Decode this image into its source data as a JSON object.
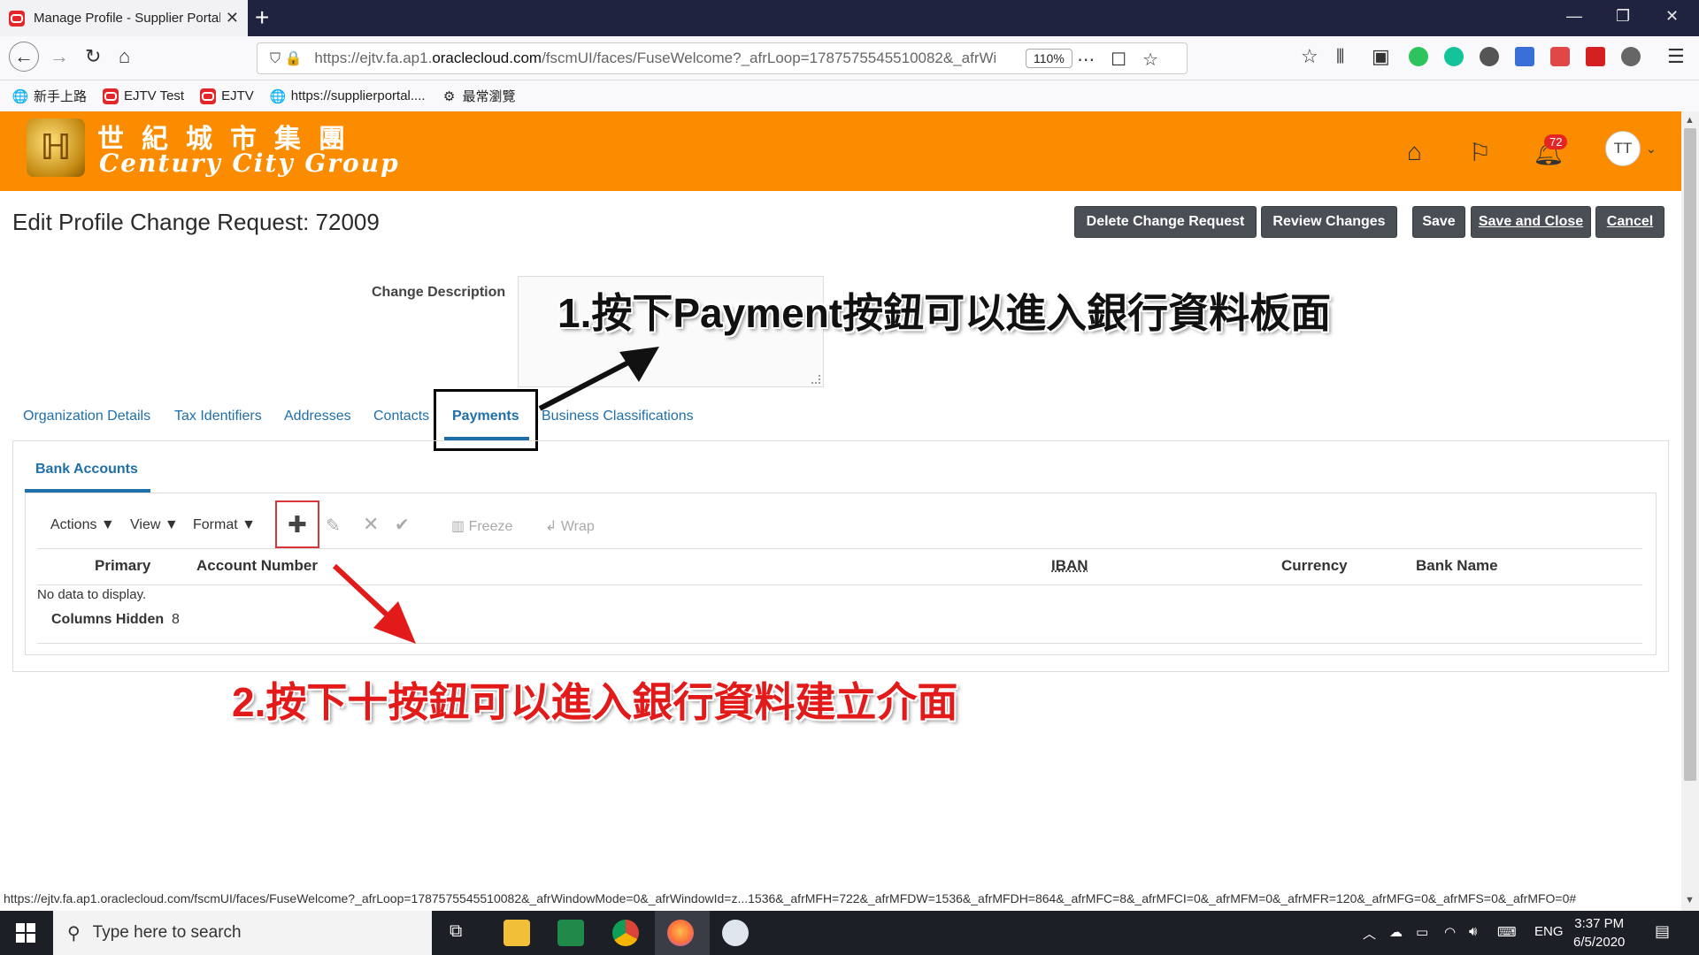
{
  "browser": {
    "tab_title": "Manage Profile - Supplier Portal",
    "url_prefix": "https://ejtv.fa.ap1.",
    "url_domain": "oraclecloud.com",
    "url_rest": "/fscmUI/faces/FuseWelcome?_afrLoop=1787575545510082&_afrWindowMode=0",
    "zoom": "110%",
    "bookmarks": [
      "新手上路",
      "EJTV Test",
      "EJTV",
      "https://supplierportal....",
      "最常瀏覽"
    ]
  },
  "header": {
    "company_cn": "世紀城市集團",
    "company_en": "Century City Group",
    "notifications_count": "72",
    "user_initials": "TT"
  },
  "page": {
    "title": "Edit Profile Change Request: 72009",
    "buttons": {
      "delete": "Delete Change Request",
      "review": "Review Changes",
      "save": "Save",
      "save_close": "Save and Close",
      "cancel": "Cancel"
    },
    "change_description_label": "Change Description",
    "tabs": [
      "Organization Details",
      "Tax Identifiers",
      "Addresses",
      "Contacts",
      "Payments",
      "Business Classifications"
    ],
    "active_tab": "Payments",
    "subtab": "Bank Accounts",
    "toolbar": {
      "actions": "Actions",
      "view": "View",
      "format": "Format",
      "freeze": "Freeze",
      "wrap": "Wrap"
    },
    "columns": [
      "Primary",
      "Account Number",
      "IBAN",
      "Currency",
      "Bank Name"
    ],
    "no_data": "No data to display.",
    "columns_hidden_label": "Columns Hidden",
    "columns_hidden_count": "8"
  },
  "annotations": {
    "note1": "1.按下Payment按鈕可以進入銀行資料板面",
    "note2": "2.按下十按鈕可以進入銀行資料建立介面"
  },
  "status_url": "https://ejtv.fa.ap1.oraclecloud.com/fscmUI/faces/FuseWelcome?_afrLoop=1787575545510082&_afrWindowMode=0&_afrWindowId=z...1536&_afrMFH=722&_afrMFDW=1536&_afrMFDH=864&_afrMFC=8&_afrMFCI=0&_afrMFM=0&_afrMFR=120&_afrMFG=0&_afrMFS=0&_afrMFO=0#",
  "taskbar": {
    "search_placeholder": "Type here to search",
    "language": "ENG",
    "time": "3:37 PM",
    "date": "6/5/2020"
  },
  "colors": {
    "brand_orange": "#fb8c00",
    "link_blue": "#1f6faa",
    "button_dark": "#4a4f55",
    "annotation_red": "#e21a1a"
  }
}
